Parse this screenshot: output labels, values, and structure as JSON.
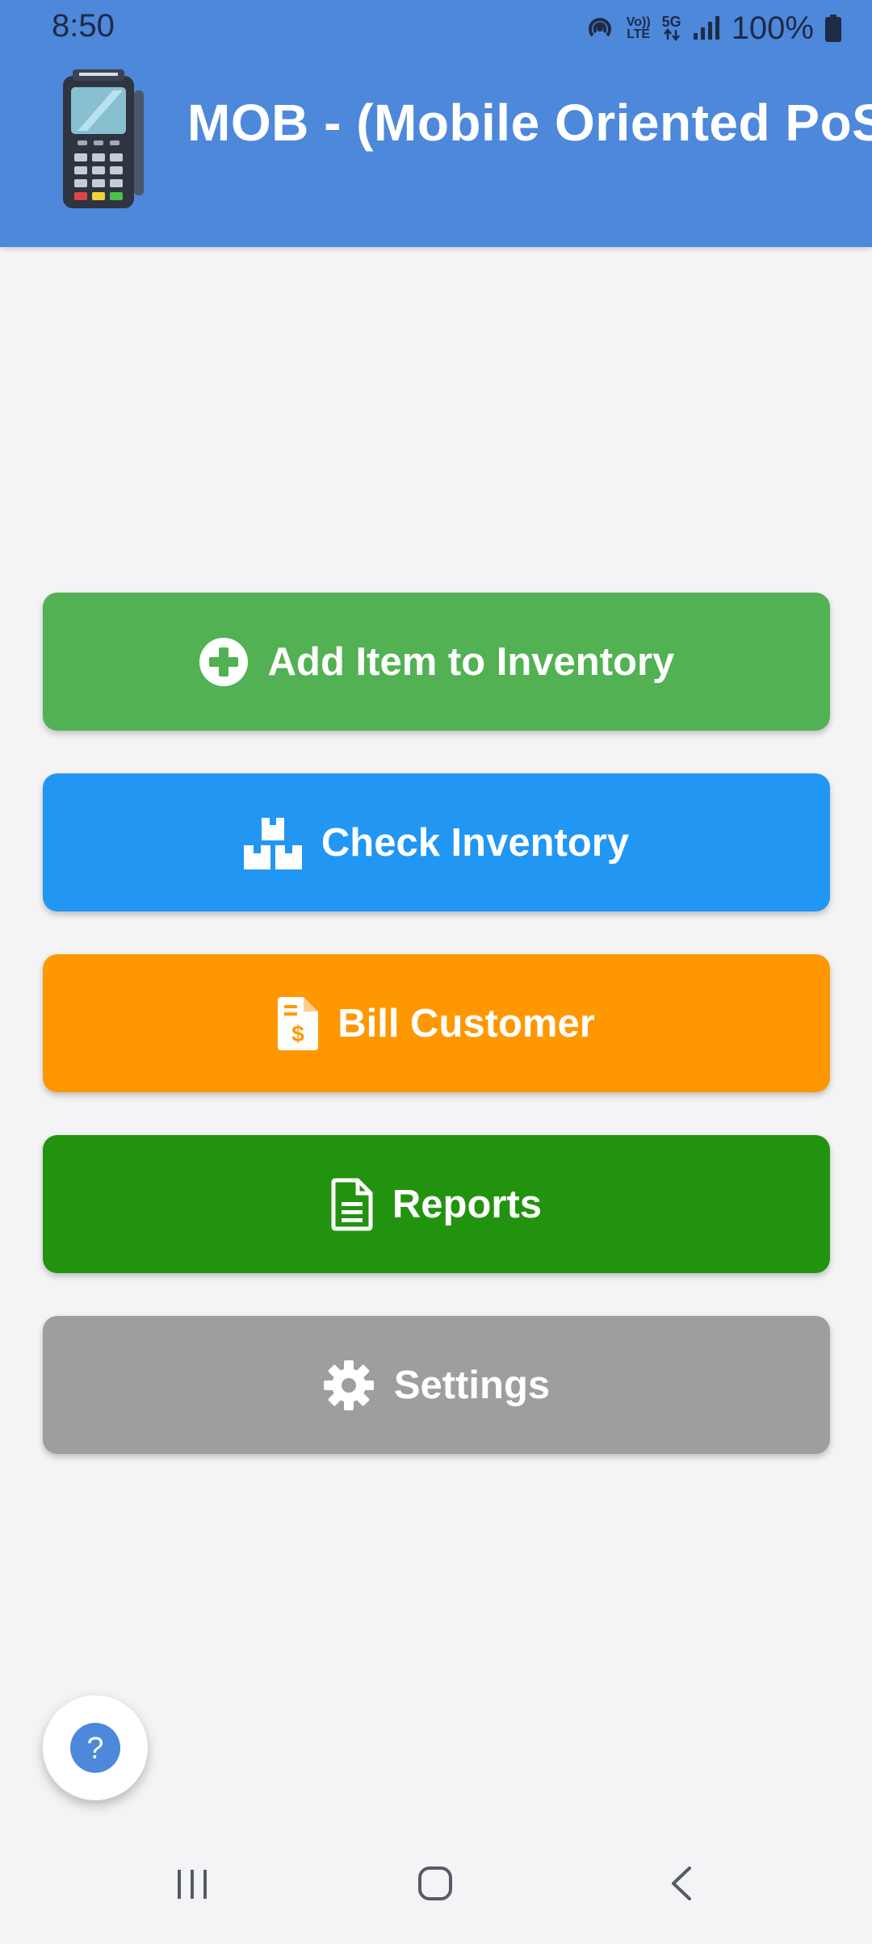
{
  "status_bar": {
    "time": "8:50",
    "volte_top": "Vo))",
    "volte_bottom": "LTE",
    "network_label": "5G",
    "battery_percent": "100%",
    "icons": [
      "hotspot-icon",
      "volte-icon",
      "5g-data-icon",
      "signal-icon",
      "battery-icon"
    ]
  },
  "app_bar": {
    "title": "MOB - (Mobile Oriented PoS)",
    "logo_icon": "pos-terminal-icon"
  },
  "menu": {
    "buttons": [
      {
        "label": "Add Item to Inventory",
        "icon": "add-circle-icon",
        "color": "#52b152"
      },
      {
        "label": "Check Inventory",
        "icon": "boxes-icon",
        "color": "#2196f3"
      },
      {
        "label": "Bill Customer",
        "icon": "invoice-dollar-icon",
        "color": "#ff9800"
      },
      {
        "label": "Reports",
        "icon": "document-icon",
        "color": "#22930e"
      },
      {
        "label": "Settings",
        "icon": "gear-icon",
        "color": "#9e9e9e"
      }
    ]
  },
  "help_fab": {
    "icon": "help-icon",
    "symbol": "?"
  },
  "nav_bar": {
    "icons": [
      "recent-apps-icon",
      "home-icon",
      "back-icon"
    ]
  },
  "colors": {
    "app_bar": "#4d88db",
    "background": "#f4f4f6",
    "text_on_button": "#ffffff"
  }
}
